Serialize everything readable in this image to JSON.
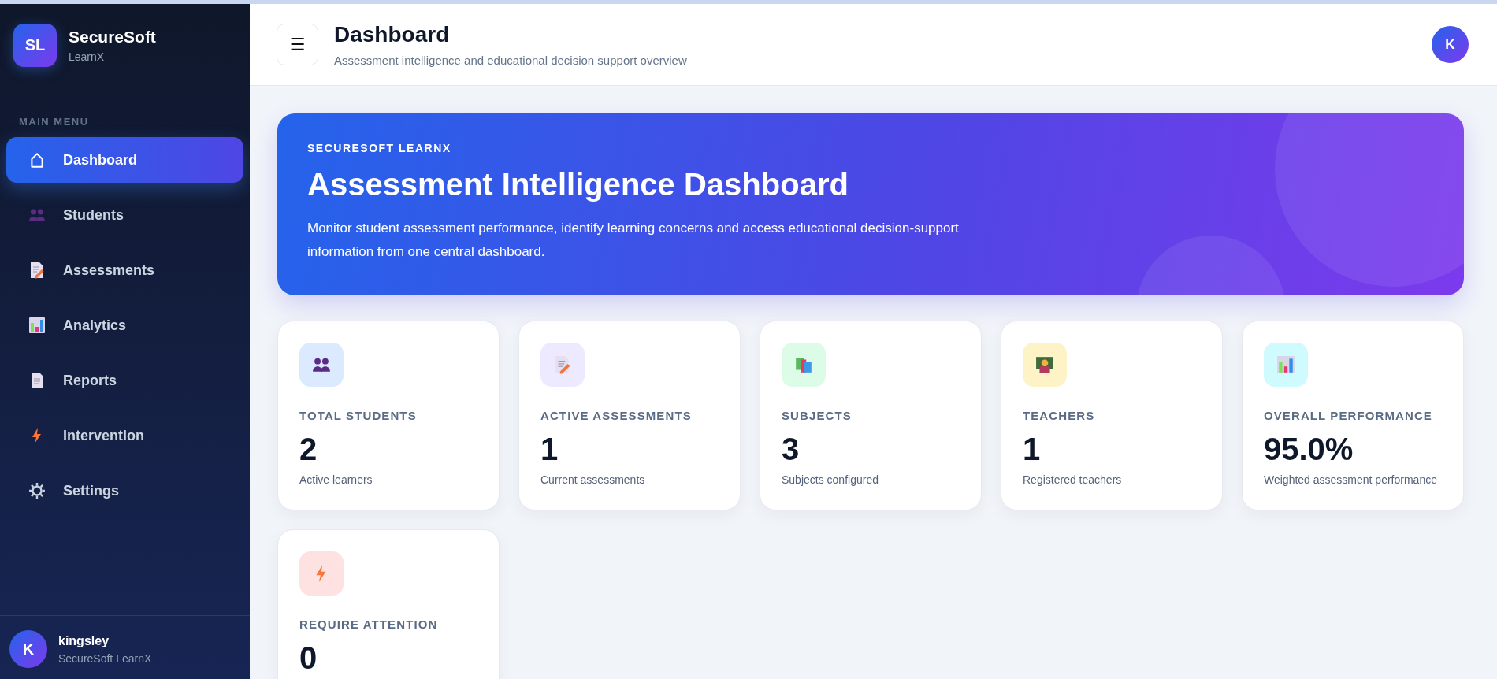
{
  "brand": {
    "logo": "SL",
    "name": "SecureSoft",
    "sub": "LearnX"
  },
  "sidebar": {
    "section": "MAIN MENU",
    "items": [
      {
        "label": "Dashboard",
        "kind": "home",
        "selected": true
      },
      {
        "label": "Students",
        "kind": "people",
        "selected": false
      },
      {
        "label": "Assessments",
        "kind": "memo",
        "selected": false
      },
      {
        "label": "Analytics",
        "kind": "chart",
        "selected": false
      },
      {
        "label": "Reports",
        "kind": "page",
        "selected": false
      },
      {
        "label": "Intervention",
        "kind": "bolt",
        "selected": false
      },
      {
        "label": "Settings",
        "kind": "gear",
        "selected": false
      }
    ]
  },
  "user": {
    "avatar": "K",
    "name": "kingsley",
    "org": "SecureSoft LearnX"
  },
  "header": {
    "menu_button": "☰",
    "title": "Dashboard",
    "subtitle": "Assessment intelligence and educational decision support overview",
    "avatar": "K"
  },
  "hero": {
    "eyebrow": "SECURESOFT LEARNX",
    "title": "Assessment Intelligence Dashboard",
    "text": "Monitor student assessment performance, identify learning concerns and access educational decision-support information from one central dashboard."
  },
  "stats": [
    {
      "kind": "people",
      "color": "#dbeafe",
      "label": "TOTAL STUDENTS",
      "value": "2",
      "note": "Active learners"
    },
    {
      "kind": "memo",
      "color": "#ede9fe",
      "label": "ACTIVE ASSESSMENTS",
      "value": "1",
      "note": "Current assessments"
    },
    {
      "kind": "books",
      "color": "#dcfce7",
      "label": "SUBJECTS",
      "value": "3",
      "note": "Subjects configured"
    },
    {
      "kind": "teacher",
      "color": "#fef3c7",
      "label": "TEACHERS",
      "value": "1",
      "note": "Registered teachers"
    },
    {
      "kind": "chart",
      "color": "#cffafe",
      "label": "OVERALL PERFORMANCE",
      "value": "95.0%",
      "note": "Weighted assessment performance"
    },
    {
      "kind": "bolt",
      "color": "#fee2e2",
      "label": "REQUIRE ATTENTION",
      "value": "0"
    }
  ]
}
